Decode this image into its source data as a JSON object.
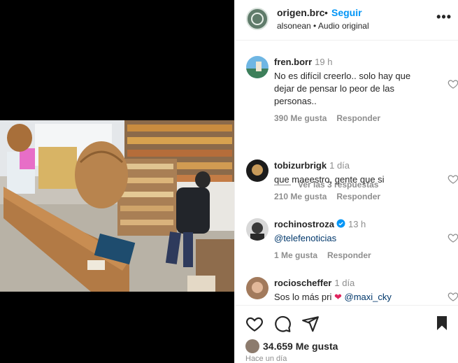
{
  "header": {
    "username": "origen.brc",
    "separator": "•",
    "follow_label": "Seguir",
    "subtitle": "alsonean • Audio original",
    "more_label": "•••"
  },
  "comments": [
    {
      "username": "fren.borr",
      "time": "19 h",
      "text": "No es difícil creerlo.. solo hay que dejar de pensar lo peor de las personas..",
      "likes": "390 Me gusta",
      "reply_label": "Responder"
    },
    {
      "username": "tobizurbrigk",
      "time": "1 día",
      "text": "que maeestro, gente que si",
      "likes": "210 Me gusta",
      "reply_label": "Responder"
    },
    {
      "username": "rochinostroza",
      "time": "13 h",
      "text": "@telefenoticias",
      "likes": "1 Me gusta",
      "reply_label": "Responder"
    },
    {
      "username": "rocioscheffer",
      "time": "1 día",
      "text_before": "Sos lo más pri",
      "mention": "@maxi_cky"
    }
  ],
  "replies_label": "Ver las 3 respuestas",
  "likes_total": "34.659 Me gusta",
  "posted_ago": "Hace un día",
  "icons": [
    "heart-icon",
    "comment-icon",
    "share-icon",
    "bookmark-icon",
    "more-icon",
    "verified-badge-icon"
  ],
  "colors": {
    "accent": "#0095f6",
    "text": "#262626",
    "muted": "#8e8e8e",
    "mention": "#00376b",
    "heart_emoji": "#e0245e"
  }
}
